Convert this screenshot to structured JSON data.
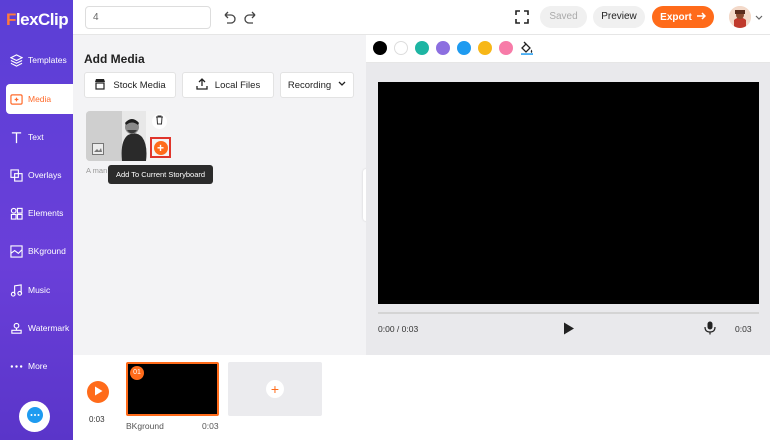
{
  "app": {
    "logo_text": "lexClip",
    "logo_f": "F"
  },
  "sidebar": {
    "items": [
      {
        "label": "Templates",
        "icon": "layers-icon"
      },
      {
        "label": "Media",
        "icon": "media-icon",
        "active": true
      },
      {
        "label": "Text",
        "icon": "text-icon"
      },
      {
        "label": "Overlays",
        "icon": "overlays-icon"
      },
      {
        "label": "Elements",
        "icon": "elements-icon"
      },
      {
        "label": "BKground",
        "icon": "background-icon"
      },
      {
        "label": "Music",
        "icon": "music-icon"
      },
      {
        "label": "Watermark",
        "icon": "watermark-icon"
      },
      {
        "label": "More",
        "icon": "more-icon"
      }
    ]
  },
  "topbar": {
    "title_value": "4",
    "saved_label": "Saved",
    "preview_label": "Preview",
    "export_label": "Export"
  },
  "media": {
    "title": "Add Media",
    "tabs": {
      "stock": "Stock Media",
      "local": "Local Files",
      "recording": "Recording"
    },
    "thumb_label": "A man",
    "tooltip": "Add To Current Storyboard"
  },
  "preview": {
    "colors": [
      "#000000",
      "#ffffff",
      "#1db5a3",
      "#8c6fe0",
      "#1e9bf0",
      "#f7b718",
      "#f77ba8"
    ],
    "time_current": "0:00 / 0:03",
    "time_total": "0:03"
  },
  "timeline": {
    "time": "0:03",
    "clip_number": "01",
    "clip_label": "BKground",
    "clip_duration": "0:03"
  }
}
